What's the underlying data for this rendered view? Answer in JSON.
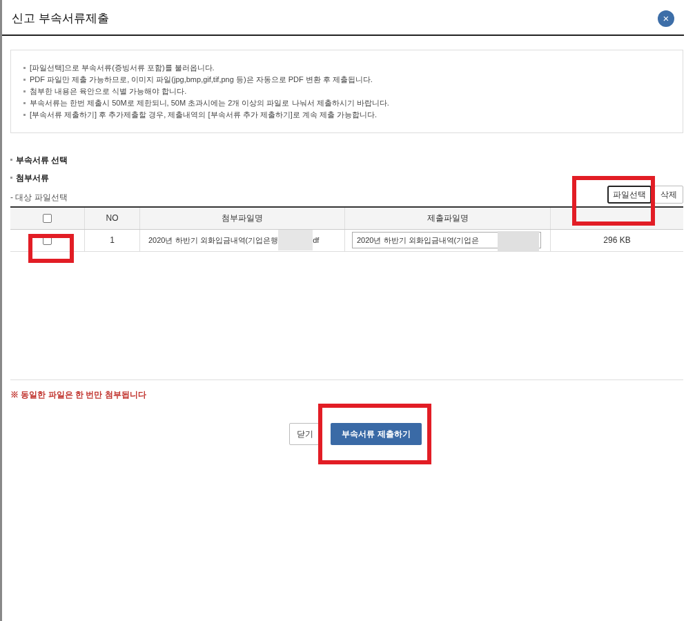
{
  "dialog": {
    "title": "신고 부속서류제출",
    "close_icon": "×"
  },
  "notices": [
    "[파일선택]으로 부속서류(증빙서류 포함)를 불러옵니다.",
    "PDF 파일만 제출 가능하므로, 이미지 파일(jpg,bmp,gif,tif,png 등)은 자동으로 PDF 변환 후 제출됩니다.",
    "첨부한 내용은 육안으로 식별 가능해야 합니다.",
    "부속서류는 한번 제출시 50M로 제한되니, 50M 초과시에는 2개 이상의 파일로 나눠서 제출하시기 바랍니다.",
    "[부속서류 제출하기] 후 추가제출할 경우, 제출내역의 [부속서류 추가 제출하기]로 계속 제출 가능합니다."
  ],
  "sections": [
    "부속서류 선택",
    "첨부서류"
  ],
  "subsection": "- 대상 파일선택",
  "toolbar": {
    "select_file": "파일선택",
    "delete": "삭제"
  },
  "table": {
    "all_checked": false,
    "columns": [
      "NO",
      "첨부파일명",
      "제출파일명"
    ],
    "rows": [
      {
        "checked": false,
        "no": "1",
        "attached_name_start": "2020년 하반기 외화입금내역(기업은행",
        "attached_name_end": "df",
        "submit_name": "2020년 하반기 외화입금내역(기업은",
        "size": "296 KB"
      }
    ]
  },
  "warning": "※ 동일한 파일은 한 번만 첨부됩니다",
  "buttons": {
    "close": "닫기",
    "submit": "부속서류 제출하기"
  }
}
